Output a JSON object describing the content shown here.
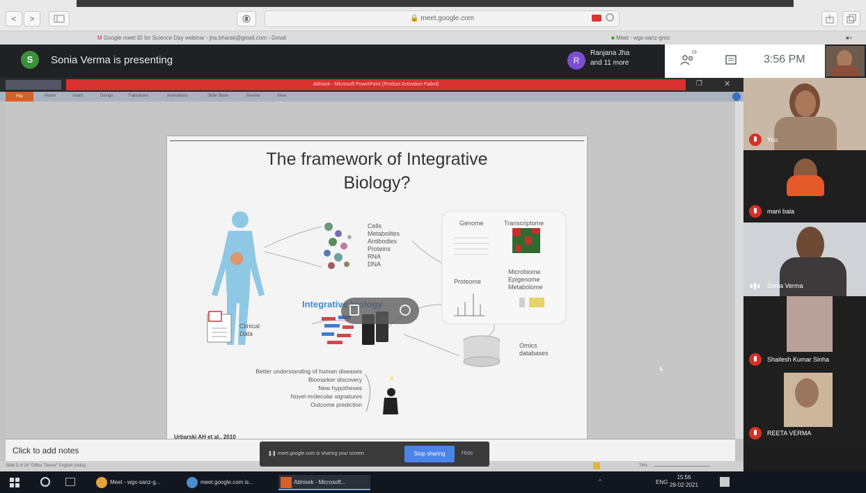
{
  "browser": {
    "url": "meet.google.com",
    "tabs": [
      "Google meet ID for Science Day webinar - jha.bharati@gmail.com - Gmail",
      "Meet - wgx-sanz-gmo"
    ],
    "back_label": "<",
    "forward_label": ">"
  },
  "meet": {
    "presenter_initial": "S",
    "presenting_text": "Sonia Verma is presenting",
    "others_initial": "R",
    "others_line1": "Ranjana Jha",
    "others_line2": "and 11 more",
    "participant_count": "19",
    "time": "3:56 PM"
  },
  "ppt": {
    "window_title": "Abhisek - Microsoft PowerPoint (Product Activation Failed)",
    "ribbon_tabs": [
      "File",
      "Home",
      "Insert",
      "Design",
      "Transitions",
      "Animations",
      "Slide Show",
      "Review",
      "View"
    ],
    "notes_placeholder": "Click to add notes",
    "status_left": "Slide 5 of 24   \"Office Theme\"   English (India)",
    "zoom": "74%"
  },
  "slide": {
    "title_line1": "The framework of Integrative",
    "title_line2": "Biology?",
    "cell_items": [
      "Cells",
      "Metabolites",
      "Antibodies",
      "Proteins",
      "RNA",
      "DNA"
    ],
    "omics": {
      "genome": "Genome",
      "transcriptome": "Transcriptome",
      "proteome": "Proteome",
      "micro_lines": [
        "Microbiome",
        "Epigenome",
        "Metabolome"
      ]
    },
    "integrative_label": "Integrative biology",
    "clinical_line1": "Clinical",
    "clinical_line2": "Data",
    "omics_db_line1": "Omics",
    "omics_db_line2": "databases",
    "outcomes": [
      "Better understanding of human diseases",
      "Biomarker discovery",
      "New hypotheses",
      "Novel molecular signatures",
      "Outcome prediction"
    ],
    "citation": "Urbarski AH et al., 2010"
  },
  "sharing": {
    "text": "meet.google.com is sharing your screen.",
    "stop_label": "Stop sharing",
    "hide_label": "Hide"
  },
  "taskbar": {
    "items": [
      "Meet - wgx-sanz-g...",
      "meet.google.com is...",
      "Abhisek - Microsoft..."
    ],
    "lang": "ENG",
    "time": "15:56",
    "date": "28-02-2021"
  },
  "participants": [
    {
      "name": "You"
    },
    {
      "name": "mani bala"
    },
    {
      "name": "Sonia Verma"
    },
    {
      "name": "Shailesh Kumar Sinha"
    },
    {
      "name": "REETA VERMA"
    }
  ],
  "colors": {
    "meet_dark": "#202124",
    "ppt_title_red": "#d93030",
    "integrative_blue": "#3b8fd6",
    "stop_sharing_blue": "#4a84e8",
    "mic_red": "#d93025"
  }
}
